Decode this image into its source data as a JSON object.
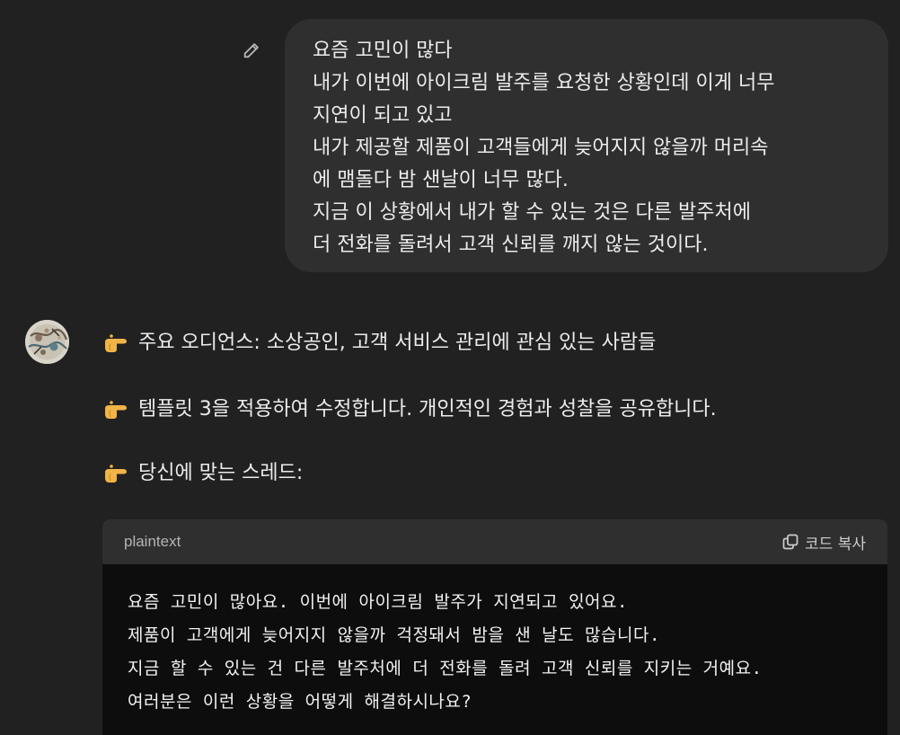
{
  "user_message": {
    "lines": [
      "요즘 고민이 많다",
      "내가 이번에 아이크림 발주를 요청한 상황인데 이게 너무",
      "지연이 되고 있고",
      "내가 제공할 제품이 고객들에게 늦어지지 않을까 머리속",
      "에 맴돌다 밤 샌날이 너무 많다.",
      "지금 이 상황에서 내가 할 수 있는 것은 다른 발주처에",
      "더 전화를 돌려서 고객 신뢰를 깨지 않는 것이다."
    ],
    "edit_icon": "pencil-icon"
  },
  "assistant": {
    "avatar_icon": "avatar-illustration",
    "points": [
      {
        "icon": "pointing-hand-emoji",
        "text": "주요 오디언스: 소상공인, 고객 서비스 관리에 관심 있는 사람들"
      },
      {
        "icon": "pointing-hand-emoji",
        "text": "템플릿 3을 적용하여 수정합니다. 개인적인 경험과 성찰을 공유합니다."
      },
      {
        "icon": "pointing-hand-emoji",
        "text": "당신에 맞는 스레드:"
      }
    ],
    "code_block": {
      "language": "plaintext",
      "copy_label": "코드 복사",
      "copy_icon": "copy-icon",
      "lines": [
        "요즘 고민이 많아요. 이번에 아이크림 발주가 지연되고 있어요.",
        "제품이 고객에게 늦어지지 않을까 걱정돼서 밤을 샌 날도 많습니다.",
        "지금 할 수 있는 건 다른 발주처에 더 전화를 돌려 고객 신뢰를 지키는 거예요.",
        "여러분은 이런 상황을 어떻게 해결하시나요?"
      ]
    }
  },
  "colors": {
    "background": "#212121",
    "bubble": "#2f2f2f",
    "code_background": "#0d0d0d",
    "text": "#ececec"
  }
}
